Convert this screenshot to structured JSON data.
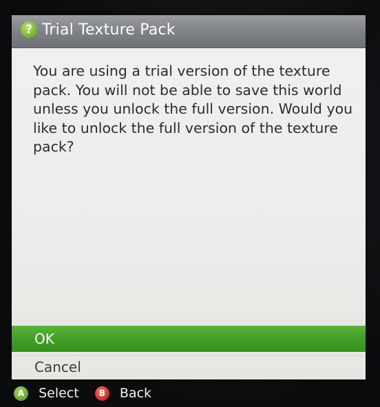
{
  "dialog": {
    "title": "Trial Texture Pack",
    "icon": "help-question-icon",
    "message": "You are using a trial version of the texture pack. You will not be able to save this world unless you unlock the full version. Would you like to unlock the full version of the texture pack?",
    "options": [
      {
        "label": "OK",
        "selected": true
      },
      {
        "label": "Cancel",
        "selected": false
      }
    ]
  },
  "controller_hints": [
    {
      "button": "A",
      "label": "Select",
      "color": "#6fab36"
    },
    {
      "button": "B",
      "label": "Back",
      "color": "#d8312b"
    }
  ],
  "colors": {
    "accent": "#3f9d25",
    "titlebar": "#7d8084",
    "dialog_bg": "#eeeeec"
  }
}
